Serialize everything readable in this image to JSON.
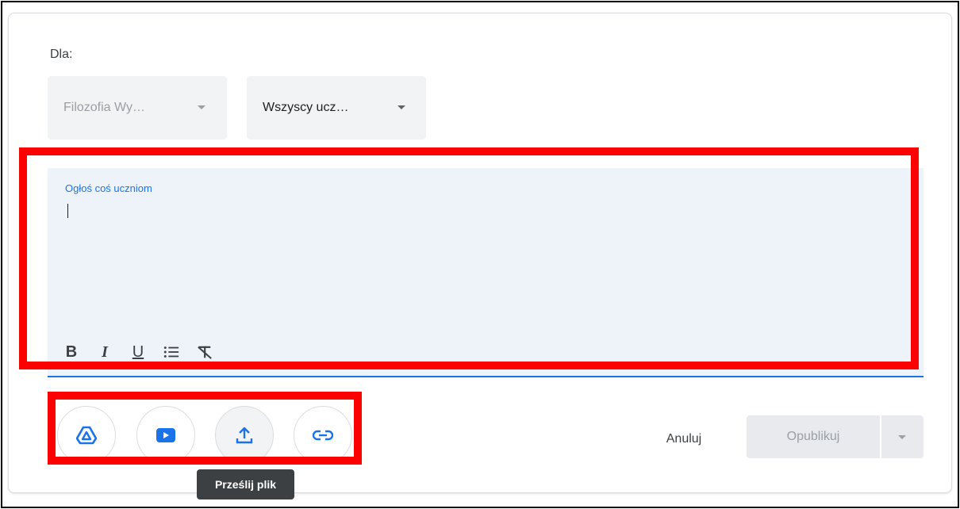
{
  "post_form": {
    "for_label": "Dla:",
    "class_select": {
      "value": "Filozofia Wy…"
    },
    "audience_select": {
      "value": "Wszyscy ucz…"
    },
    "editor": {
      "label": "Ogłoś coś uczniom",
      "value": ""
    },
    "format_toolbar": {
      "bold": "B",
      "italic": "I",
      "underline": "U"
    }
  },
  "attachments": {
    "icons": [
      "drive-icon",
      "youtube-icon",
      "upload-icon",
      "link-icon"
    ],
    "tooltip": "Prześlij plik"
  },
  "actions": {
    "cancel_label": "Anuluj",
    "publish_label": "Opublikuj"
  },
  "colors": {
    "accent_blue": "#1a73e8",
    "highlight_red": "#ff0000",
    "disabled_button_bg": "#e8eaed",
    "editor_bg": "#eef3f9"
  }
}
